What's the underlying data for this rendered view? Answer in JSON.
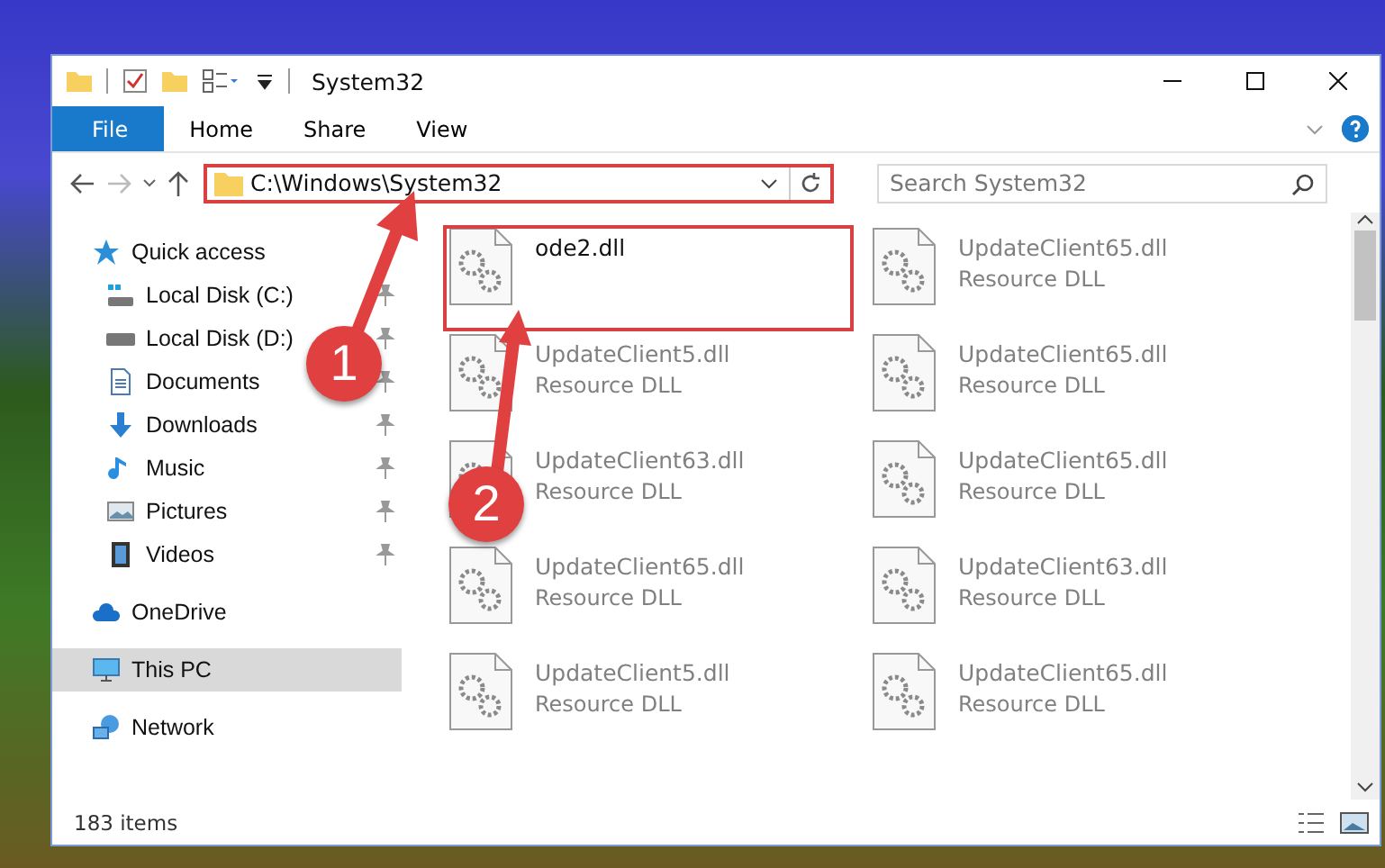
{
  "window": {
    "title": "System32"
  },
  "ribbon": {
    "tabs": [
      {
        "label": "File",
        "kind": "file"
      },
      {
        "label": "Home",
        "kind": "tab"
      },
      {
        "label": "Share",
        "kind": "tab"
      },
      {
        "label": "View",
        "kind": "tab"
      }
    ]
  },
  "address": {
    "path": "C:\\Windows\\System32"
  },
  "search": {
    "placeholder": "Search System32"
  },
  "nav": {
    "items": [
      {
        "label": "Quick access",
        "selected": false,
        "pinned": false,
        "children": [
          {
            "label": "Local Disk (C:)",
            "selected": false,
            "pinned": true
          },
          {
            "label": "Local Disk (D:)",
            "selected": false,
            "pinned": true
          },
          {
            "label": "Documents",
            "selected": false,
            "pinned": true
          },
          {
            "label": "Downloads",
            "selected": false,
            "pinned": true
          },
          {
            "label": "Music",
            "selected": false,
            "pinned": true
          },
          {
            "label": "Pictures",
            "selected": false,
            "pinned": true
          },
          {
            "label": "Videos",
            "selected": false,
            "pinned": true
          }
        ]
      },
      {
        "label": "OneDrive",
        "selected": false,
        "pinned": false
      },
      {
        "label": "This PC",
        "selected": true,
        "pinned": false
      },
      {
        "label": "Network",
        "selected": false,
        "pinned": false
      }
    ]
  },
  "files": [
    {
      "name": "ode2.dll",
      "blurred": false
    },
    {
      "name": "UpdateClient65.dll",
      "type": "Resource DLL",
      "blurred": true
    },
    {
      "name": "UpdateClient5.dll",
      "type": "Resource DLL",
      "blurred": true
    },
    {
      "name": "UpdateClient65.dll",
      "type": "Resource DLL",
      "blurred": true
    },
    {
      "name": "UpdateClient63.dll",
      "type": "Resource DLL",
      "blurred": true
    },
    {
      "name": "UpdateClient65.dll",
      "type": "Resource DLL",
      "blurred": true
    },
    {
      "name": "UpdateClient65.dll",
      "type": "Resource DLL",
      "blurred": true
    },
    {
      "name": "UpdateClient63.dll",
      "type": "Resource DLL",
      "blurred": true
    },
    {
      "name": "UpdateClient5.dll",
      "type": "Resource DLL",
      "blurred": true
    },
    {
      "name": "UpdateClient65.dll",
      "type": "Resource DLL",
      "blurred": true
    }
  ],
  "status_bar": {
    "count": "183 items"
  },
  "annotations": [
    {
      "number": "1"
    },
    {
      "number": "2"
    }
  ]
}
